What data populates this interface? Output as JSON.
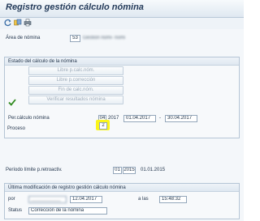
{
  "title": "Registro gestión cálculo nómina",
  "toolbar": {
    "icons": [
      "refresh-icon",
      "other-objects-icon",
      "print-icon"
    ]
  },
  "area": {
    "label": "Área de nómina",
    "code": "53",
    "text": "Gestión nomi- nomi"
  },
  "status_group": {
    "title": "Estado del cálculo de la nómina",
    "check_icon": "checkmark-icon",
    "buttons": [
      "Libre p.calc.nóm.",
      "Libre p.corrección",
      "Fin de calc.nóm.",
      "Verificar resultados nómina"
    ],
    "period_label": "Per.cálculo nómina",
    "period_num": "04",
    "period_year": "2017",
    "date_from": "01.04.2017",
    "dash": "-",
    "date_to": "30.04.2017",
    "proceso_label": "Proceso",
    "proceso_value": "2"
  },
  "retro": {
    "label": "Período límite p.retroactiv.",
    "num": "01",
    "year": "2015",
    "date": "01.01.2015"
  },
  "last_mod": {
    "title": "Última modificación de registro gestión cálculo nómina",
    "por_label": "por",
    "por_value": "___________",
    "date": "12.04.2017",
    "time_label": "a las",
    "time": "15:48:32",
    "status_label": "Status",
    "status_value": "Corrección de la nómina"
  }
}
